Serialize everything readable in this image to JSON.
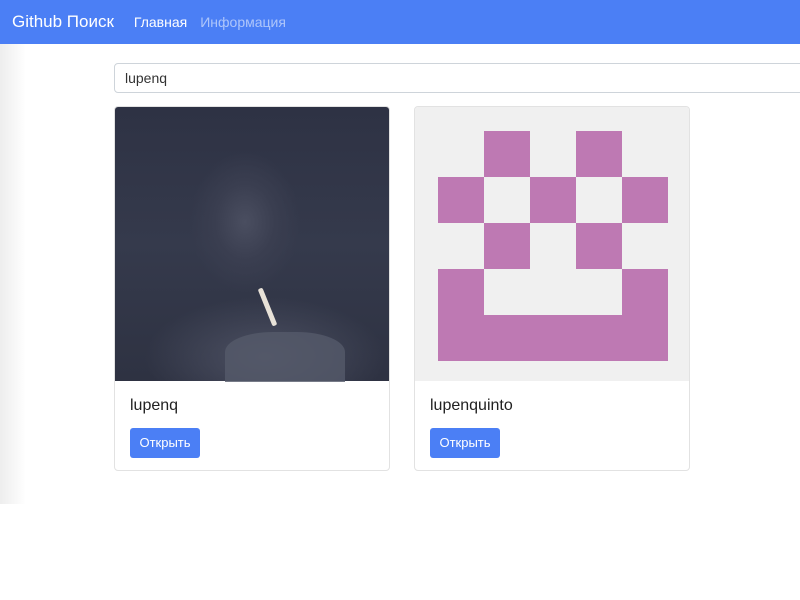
{
  "navbar": {
    "brand": "Github Поиск",
    "links": [
      {
        "label": "Главная",
        "active": true
      },
      {
        "label": "Информация",
        "active": false
      }
    ],
    "color": "#4b7ff5"
  },
  "search": {
    "value": "lupenq"
  },
  "results": [
    {
      "login": "lupenq",
      "button_label": "Открыть",
      "avatar": "photo"
    },
    {
      "login": "lupenquinto",
      "button_label": "Открыть",
      "avatar": "identicon",
      "identicon_color": "#be79b3"
    }
  ]
}
